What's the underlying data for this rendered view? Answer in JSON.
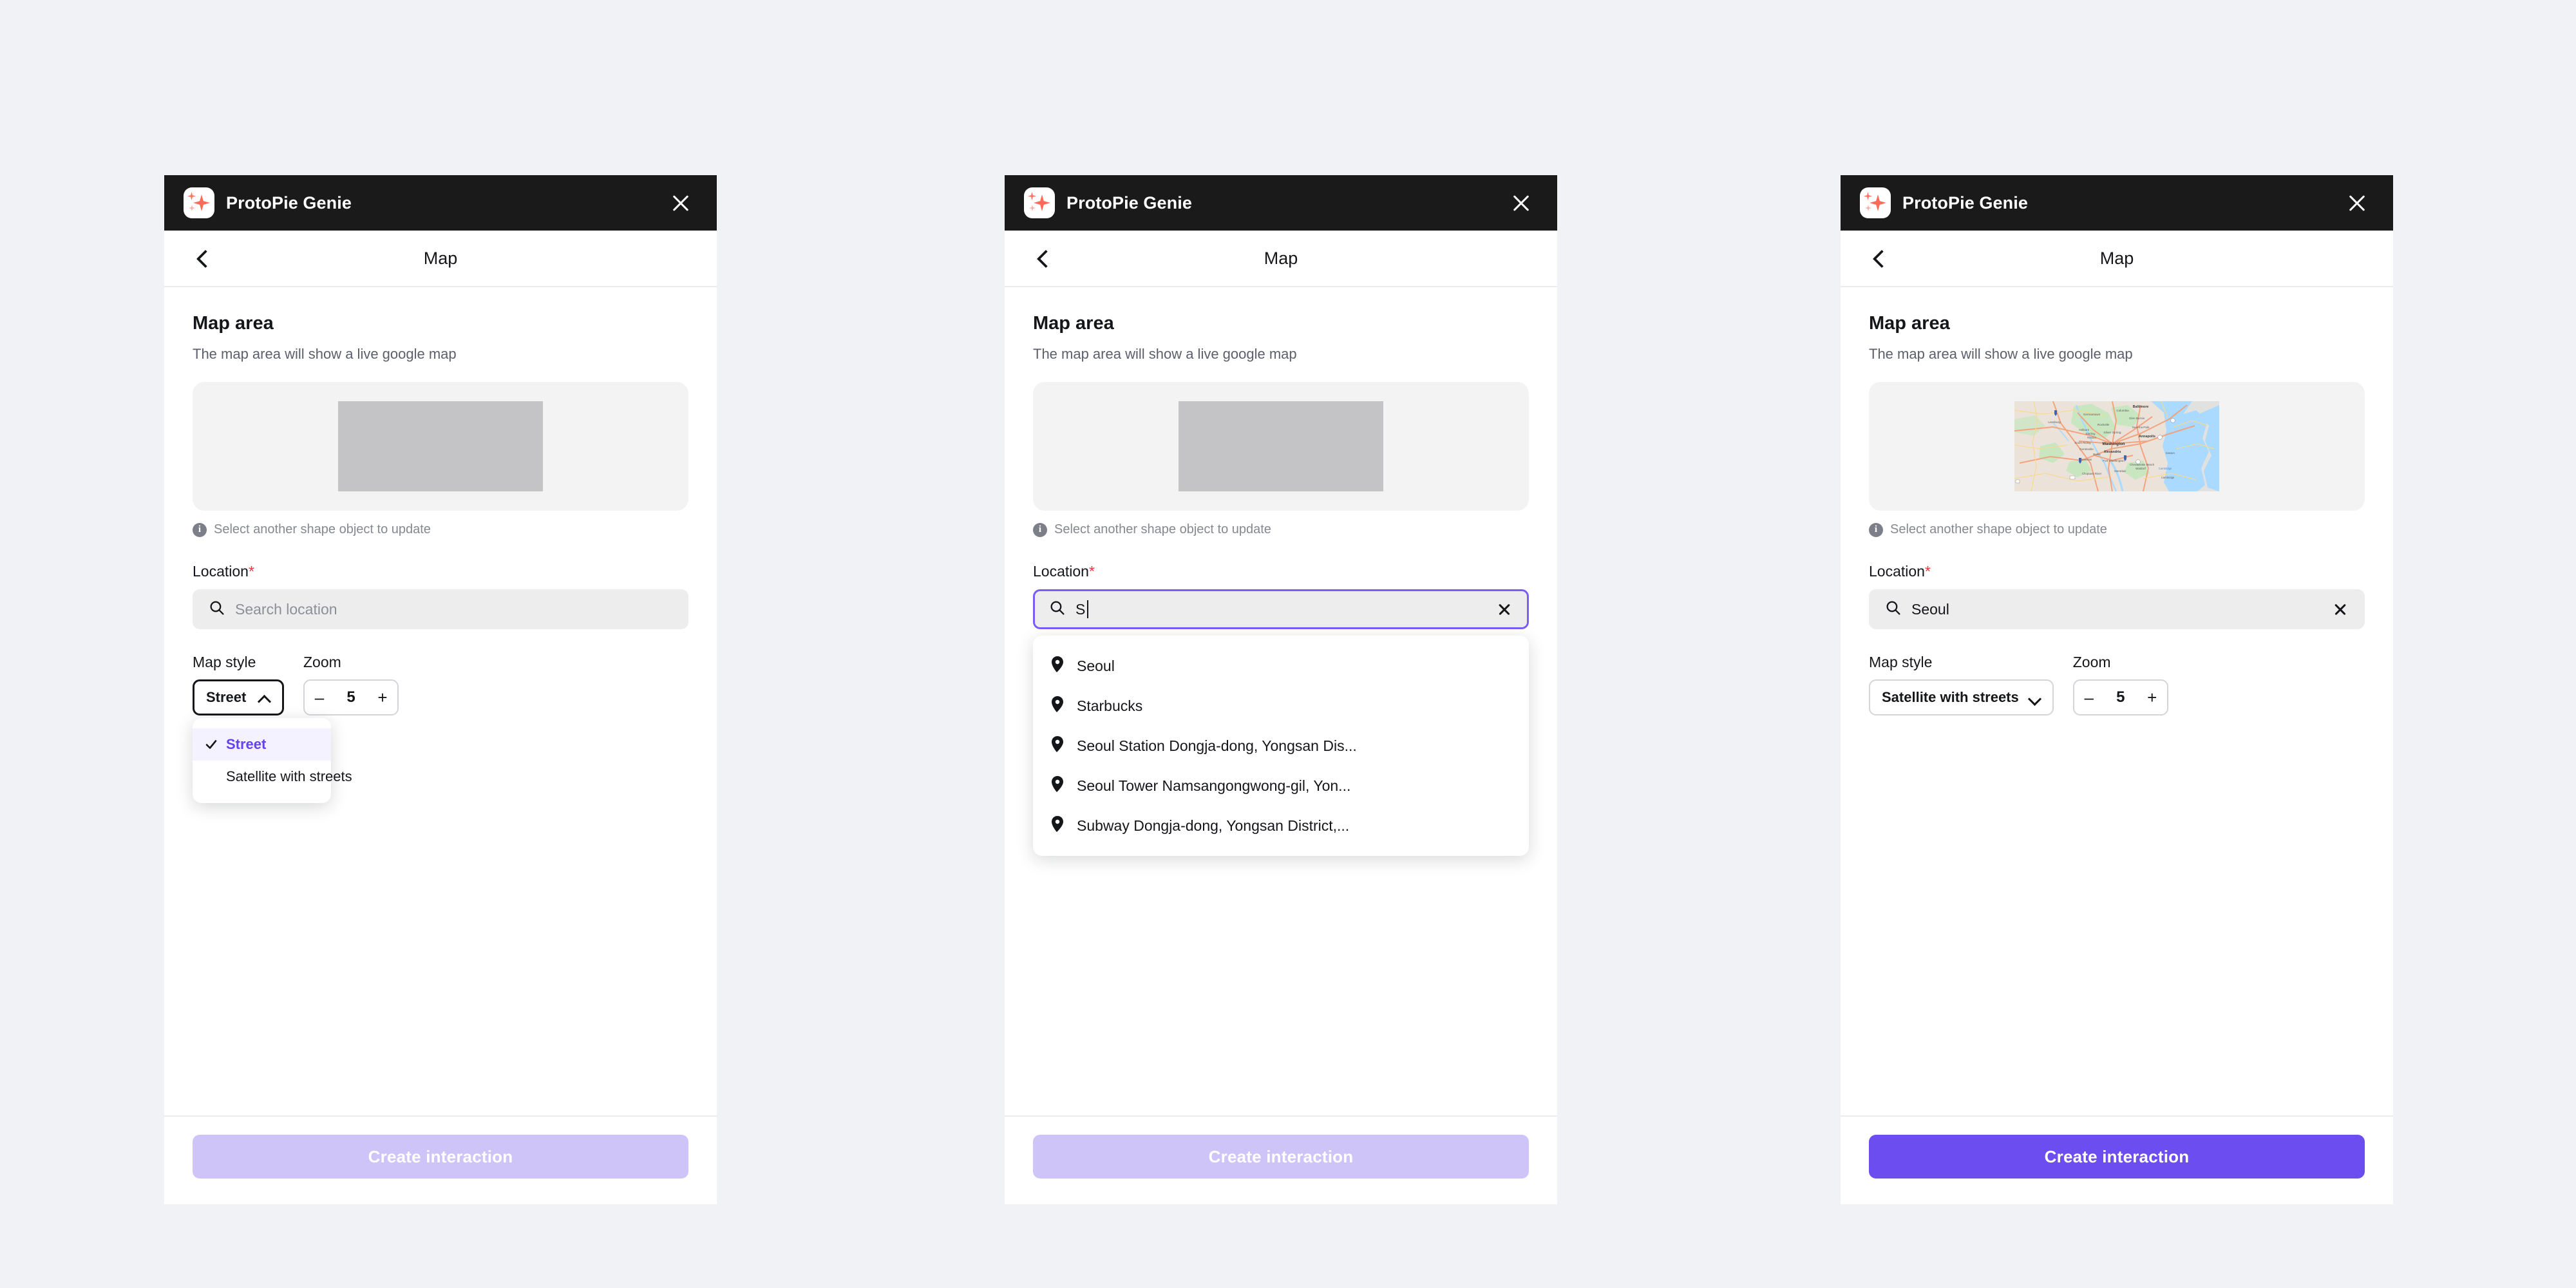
{
  "theme": {
    "page_background": "#f1f2f6",
    "titlebar_background": "#1a1a1a",
    "accent_purple": "#6c4ef0",
    "accent_purple_disabled": "#cfc4f8",
    "accent_selected_text": "#6542ef",
    "required_red": "#e8393b",
    "logo_sparkle": "#fa6b5a",
    "focus_border": "#7c5cf5"
  },
  "app": {
    "name": "ProtoPie Genie",
    "logo_icon": "sparkle-icon",
    "close_icon": "close-icon"
  },
  "nav": {
    "back_icon": "chevron-left-icon",
    "title": "Map"
  },
  "section": {
    "title": "Map area",
    "subtitle": "The map area will show a live google map",
    "hint_icon": "info-icon",
    "hint_text": "Select another shape object to update"
  },
  "location": {
    "label": "Location",
    "required_mark": "*",
    "search_icon": "search-icon",
    "clear_icon": "close-icon",
    "placeholder": "Search location"
  },
  "map_style": {
    "label": "Map style",
    "chevron_down_icon": "chevron-down-icon",
    "chevron_up_icon": "chevron-up-icon",
    "check_icon": "check-icon",
    "options": [
      "Street",
      "Satellite with streets"
    ]
  },
  "zoom": {
    "label": "Zoom",
    "decrement_label": "–",
    "increment_label": "+",
    "value": "5"
  },
  "footer": {
    "cta_label": "Create interaction"
  },
  "panels": [
    {
      "id": "panel-style-dropdown-open",
      "preview_kind": "placeholder",
      "search_value": "",
      "search_is_placeholder": true,
      "search_focused": false,
      "show_clear": false,
      "show_caret": false,
      "suggestions_open": false,
      "style_value": "Street",
      "style_menu_open": true,
      "style_selected_index": 0,
      "cta_enabled": false
    },
    {
      "id": "panel-search-typing",
      "preview_kind": "placeholder",
      "search_value": "S",
      "search_is_placeholder": false,
      "search_focused": true,
      "show_clear": true,
      "show_caret": true,
      "suggestions_open": true,
      "style_value": "Street",
      "style_menu_open": false,
      "style_selected_index": 0,
      "cta_enabled": false
    },
    {
      "id": "panel-location-selected",
      "preview_kind": "map",
      "search_value": "Seoul",
      "search_is_placeholder": false,
      "search_focused": false,
      "show_clear": true,
      "show_caret": false,
      "suggestions_open": false,
      "style_value": "Satellite with streets",
      "style_menu_open": false,
      "style_selected_index": 1,
      "cta_enabled": true
    }
  ],
  "suggestions": [
    {
      "icon": "map-pin-icon",
      "label": "Seoul"
    },
    {
      "icon": "map-pin-icon",
      "label": "Starbucks"
    },
    {
      "icon": "map-pin-icon",
      "label": "Seoul Station Dongja-dong, Yongsan Dis..."
    },
    {
      "icon": "map-pin-icon",
      "label": "Seoul Tower Namsangongwong-gil, Yon..."
    },
    {
      "icon": "map-pin-icon",
      "label": "Subway Dongja-dong, Yongsan District,..."
    }
  ],
  "map_thumbnail": {
    "description": "Google Maps street view of the Washington DC and Chesapeake Bay region",
    "labels": [
      "Baltimore",
      "Columbia",
      "Germantown",
      "Glen Burnie",
      "Leesburg",
      "Rockville",
      "Severna Park",
      "Ashburn",
      "Sterling",
      "Silver Spring",
      "Annapolis",
      "Reston",
      "South Riding",
      "Washington",
      "Centreville",
      "Alexandria",
      "Easton",
      "Burke",
      "Manassas",
      "Fort Washington",
      "Chesapeake Beach",
      "Waldorf",
      "Montclair",
      "Choptank River",
      "Cambridge"
    ],
    "colors": {
      "land": "#ebe3d9",
      "water": "#aadaff",
      "park": "#c8e6c0",
      "highway": "#f4a07a",
      "road": "#f9d98a"
    }
  }
}
